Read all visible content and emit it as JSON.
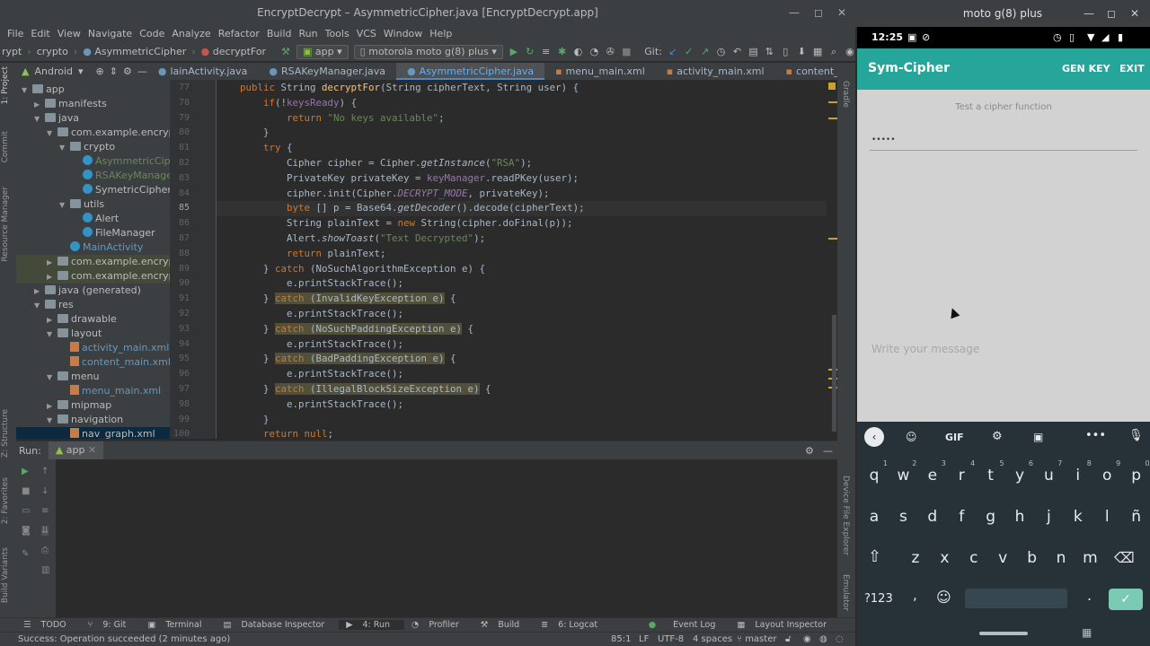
{
  "ide": {
    "title": "EncryptDecrypt – AsymmetricCipher.java [EncryptDecrypt.app]",
    "menu": [
      "File",
      "Edit",
      "View",
      "Navigate",
      "Code",
      "Analyze",
      "Refactor",
      "Build",
      "Run",
      "Tools",
      "VCS",
      "Window",
      "Help"
    ],
    "breadcrumbs": {
      "pkg": "crypto",
      "cls": "AsymmetricCipher",
      "method": "decryptFor",
      "prefix": "rypt"
    },
    "run_config": "app",
    "device": "motorola moto g(8) plus",
    "git_label": "Git:",
    "project_view": "Android",
    "tabs": [
      {
        "label": "lainActivity.java"
      },
      {
        "label": "RSAKeyManager.java"
      },
      {
        "label": "AsymmetricCipher.java"
      },
      {
        "label": "menu_main.xml"
      },
      {
        "label": "activity_main.xml"
      },
      {
        "label": "content_main.xml"
      }
    ],
    "left_strip": [
      "1: Project",
      "Commit",
      "Resource Manager",
      "Z: Structure",
      "2: Favorites",
      "Build Variants"
    ],
    "right_strip": [
      "Gradle",
      "Device File Explorer",
      "Emulator"
    ],
    "tree": [
      {
        "label": "app",
        "depth": 0,
        "arrow": "▼",
        "icon": "folder"
      },
      {
        "label": "manifests",
        "depth": 1,
        "arrow": "▶",
        "icon": "folder"
      },
      {
        "label": "java",
        "depth": 1,
        "arrow": "▼",
        "icon": "folder"
      },
      {
        "label": "com.example.encryptdec",
        "depth": 2,
        "arrow": "▼",
        "icon": "folder"
      },
      {
        "label": "crypto",
        "depth": 3,
        "arrow": "▼",
        "icon": "folder"
      },
      {
        "label": "AsymmetricCiphe",
        "depth": 4,
        "arrow": "",
        "icon": "class",
        "style": "kt"
      },
      {
        "label": "RSAKeyManager",
        "depth": 4,
        "arrow": "",
        "icon": "class",
        "style": "kt"
      },
      {
        "label": "SymetricCipher",
        "depth": 4,
        "arrow": "",
        "icon": "class"
      },
      {
        "label": "utils",
        "depth": 3,
        "arrow": "▼",
        "icon": "folder"
      },
      {
        "label": "Alert",
        "depth": 4,
        "arrow": "",
        "icon": "class"
      },
      {
        "label": "FileManager",
        "depth": 4,
        "arrow": "",
        "icon": "class"
      },
      {
        "label": "MainActivity",
        "depth": 3,
        "arrow": "",
        "icon": "class",
        "style": "blue"
      },
      {
        "label": "com.example.encryptdec",
        "depth": 2,
        "arrow": "▶",
        "icon": "folder",
        "style": "hl"
      },
      {
        "label": "com.example.encryptdec",
        "depth": 2,
        "arrow": "▶",
        "icon": "folder",
        "style": "hl"
      },
      {
        "label": "java (generated)",
        "depth": 1,
        "arrow": "▶",
        "icon": "folder"
      },
      {
        "label": "res",
        "depth": 1,
        "arrow": "▼",
        "icon": "folder"
      },
      {
        "label": "drawable",
        "depth": 2,
        "arrow": "▶",
        "icon": "folder"
      },
      {
        "label": "layout",
        "depth": 2,
        "arrow": "▼",
        "icon": "folder"
      },
      {
        "label": "activity_main.xml",
        "depth": 3,
        "arrow": "",
        "icon": "xml",
        "style": "blue"
      },
      {
        "label": "content_main.xml",
        "depth": 3,
        "arrow": "",
        "icon": "xml",
        "style": "blue"
      },
      {
        "label": "menu",
        "depth": 2,
        "arrow": "▼",
        "icon": "folder"
      },
      {
        "label": "menu_main.xml",
        "depth": 3,
        "arrow": "",
        "icon": "xml",
        "style": "blue"
      },
      {
        "label": "mipmap",
        "depth": 2,
        "arrow": "▶",
        "icon": "folder"
      },
      {
        "label": "navigation",
        "depth": 2,
        "arrow": "▼",
        "icon": "folder"
      },
      {
        "label": "nav_graph.xml",
        "depth": 3,
        "arrow": "",
        "icon": "xml",
        "style": "sel"
      }
    ],
    "line_numbers": [
      "77",
      "78",
      "79",
      "80",
      "81",
      "82",
      "83",
      "84",
      "85",
      "86",
      "87",
      "88",
      "89",
      "90",
      "91",
      "92",
      "93",
      "94",
      "95",
      "96",
      "97",
      "98",
      "99",
      "100"
    ],
    "code_lines": [
      "    <span class=\"kw\">public</span> String <span class=\"fn\">decryptFor</span>(String cipherText, String user) {",
      "        <span class=\"kw\">if</span>(!<span class=\"fld\">keysReady</span>) {",
      "            <span class=\"kw\">return</span> <span class=\"str\">\"No keys available\"</span>;",
      "        }",
      "        <span class=\"kw\">try</span> {",
      "            Cipher cipher = Cipher.<span class=\"it\">getInstance</span>(<span class=\"str\">\"RSA\"</span>);",
      "            PrivateKey privateKey = <span class=\"fld\">keyManager</span>.readPKey(user);",
      "            cipher.init(Cipher.<span class=\"fld it\">DECRYPT_MODE</span>, privateKey);",
      "            <span class=\"kw\">byte</span> [] p = Base64.<span class=\"it\">getDecoder</span>().decode(cipherText);",
      "            String plainText = <span class=\"kw\">new</span> String(cipher.doFinal(p));",
      "            Alert.<span class=\"it\">showToast</span>(<span class=\"str\">\"Text Decrypted\"</span>);",
      "            <span class=\"kw\">return</span> plainText;",
      "        } <span class=\"kw\">catch</span> (NoSuchAlgorithmException e) {",
      "            e.printStackTrace();",
      "        } <span class=\"warnbg\"><span class=\"kw\">catch</span> (InvalidKeyException e)</span> {",
      "            e.printStackTrace();",
      "        } <span class=\"warnbg\"><span class=\"kw\">catch</span> (NoSuchPaddingException e)</span> {",
      "            e.printStackTrace();",
      "        } <span class=\"warnbg\"><span class=\"kw\">catch</span> (BadPaddingException e)</span> {",
      "            e.printStackTrace();",
      "        } <span class=\"warnbg\"><span class=\"kw\">catch</span> (IllegalBlockSizeException e)</span> {",
      "            e.printStackTrace();",
      "        }",
      "        <span class=\"kw\">return null</span>;"
    ],
    "run_panel": {
      "label": "Run:",
      "config": "app"
    },
    "bottom_tabs": [
      "TODO",
      "9: Git",
      "Terminal",
      "Database Inspector",
      "4: Run",
      "Profiler",
      "Build",
      "6: Logcat",
      "Event Log",
      "Layout Inspector"
    ],
    "status": {
      "message": "Success: Operation succeeded (2 minutes ago)",
      "position": "85:1",
      "line_sep": "LF",
      "encoding": "UTF-8",
      "indent": "4 spaces",
      "branch": "master"
    }
  },
  "emulator": {
    "title": "moto g(8) plus",
    "time": "12:25",
    "app_title": "Sym-Cipher",
    "actions": [
      "GEN KEY",
      "EXIT"
    ],
    "subtitle": "Test a cipher function",
    "password_value": "•••••",
    "message_placeholder": "Write your message",
    "kb_tool": [
      "GIF"
    ],
    "row1": [
      [
        "q",
        "1"
      ],
      [
        "w",
        "2"
      ],
      [
        "e",
        "3"
      ],
      [
        "r",
        "4"
      ],
      [
        "t",
        "5"
      ],
      [
        "y",
        "6"
      ],
      [
        "u",
        "7"
      ],
      [
        "i",
        "8"
      ],
      [
        "o",
        "9"
      ],
      [
        "p",
        "0"
      ]
    ],
    "row2": [
      "a",
      "s",
      "d",
      "f",
      "g",
      "h",
      "j",
      "k",
      "l",
      "ñ"
    ],
    "row3": [
      "z",
      "x",
      "c",
      "v",
      "b",
      "n",
      "m"
    ],
    "row4": {
      "sym": "?123",
      "comma": ",",
      "period": "."
    }
  },
  "colors": {
    "accent": "#26a69a",
    "ide_bg": "#2b2b2b",
    "kw": "#cc7832",
    "str": "#6a8759"
  }
}
